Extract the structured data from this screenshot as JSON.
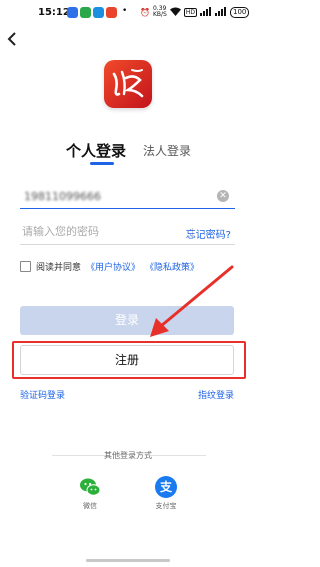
{
  "status_bar": {
    "time": "15:12",
    "network_speed_value": "0.39",
    "network_speed_unit": "KB/S",
    "battery": "100"
  },
  "tabs": {
    "personal": "个人登录",
    "legal": "法人登录"
  },
  "form": {
    "phone_value": "19811099666",
    "password_placeholder": "请输入您的密码",
    "forgot_password": "忘记密码?"
  },
  "agreement": {
    "prefix": "阅读并同意",
    "user_agreement": "《用户协议》",
    "privacy_policy": "《隐私政策》"
  },
  "buttons": {
    "login": "登录",
    "register": "注册",
    "sms_login": "验证码登录",
    "fingerprint_login": "指纹登录"
  },
  "other_login": {
    "title": "其他登录方式",
    "wechat": "微信",
    "alipay": "支付宝",
    "alipay_glyph": "支"
  },
  "colors": {
    "accent": "#1f63e6",
    "brand_red": "#d8271f",
    "highlight": "#e8302b",
    "wechat": "#2bb03a",
    "alipay": "#1a7af0"
  },
  "icons": {
    "back": "back-arrow-icon",
    "clear": "clear-icon",
    "app_logo": "app-logo",
    "wechat": "wechat-icon",
    "alipay": "alipay-icon"
  }
}
